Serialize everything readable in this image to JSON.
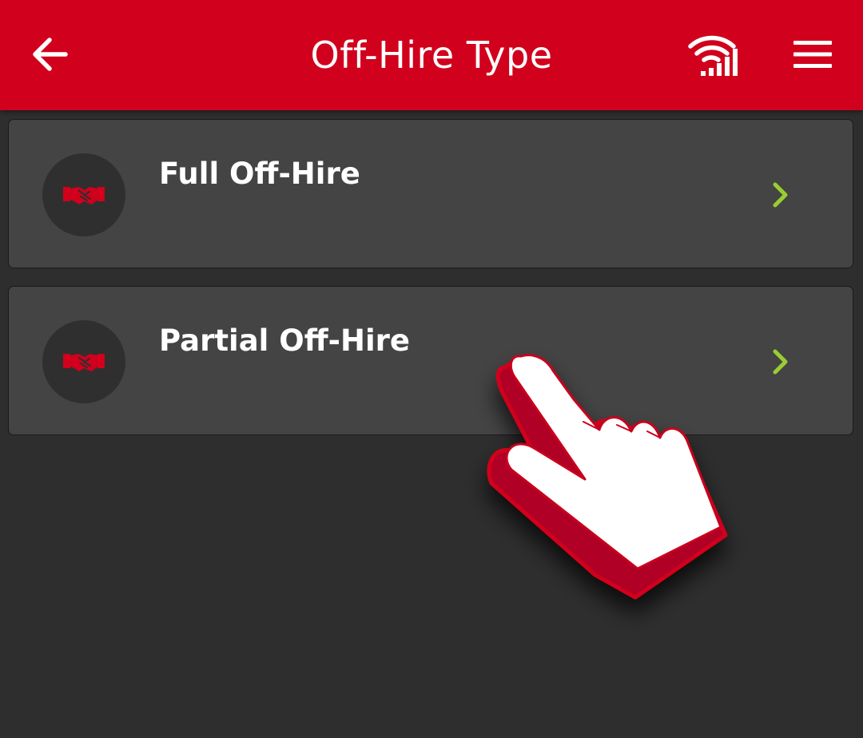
{
  "header": {
    "title": "Off-Hire Type",
    "back_icon": "arrow-left-icon",
    "signal_icon": "wifi-signal-icon",
    "menu_icon": "hamburger-menu-icon"
  },
  "options": [
    {
      "label": "Full Off-Hire",
      "icon": "handshake-icon",
      "action_icon": "chevron-right-icon"
    },
    {
      "label": "Partial Off-Hire",
      "icon": "handshake-icon",
      "action_icon": "chevron-right-icon"
    }
  ],
  "overlay": {
    "icon": "pointing-hand-icon"
  },
  "colors": {
    "brand_red": "#d1001c",
    "background": "#2e2e2e",
    "card": "#444444",
    "icon_circle": "#2f2f2f",
    "chevron": "#9acd32",
    "text": "#ffffff"
  }
}
